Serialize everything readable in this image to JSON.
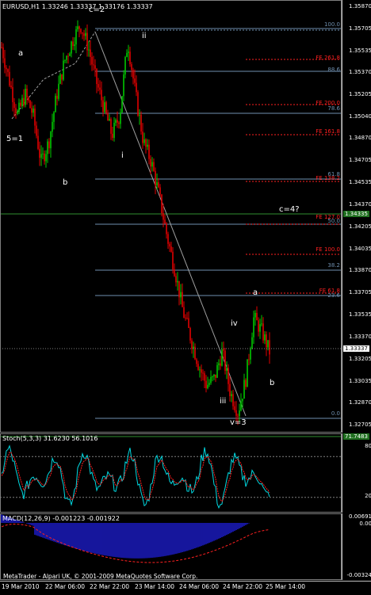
{
  "chart_header": "EURUSD,H1  1.33246 1.33337 1.33176 1.33337",
  "stoch_header": "Stoch(5,3,3) 31.6230 56.1016",
  "macd_header": "MACD(12,26,9) -0.001223 -0.001922",
  "copyright": "MetaTrader - Alpari UK, © 2001-2009 MetaQuotes Software Corp.",
  "current_price": "1.33337",
  "green_price": "1.34335",
  "stoch_value": "71.7483",
  "price_axis": [
    "1.35870",
    "1.35705",
    "1.35535",
    "1.35370",
    "1.35205",
    "1.35040",
    "1.34870",
    "1.34705",
    "1.34535",
    "1.34370",
    "1.34205",
    "1.34035",
    "1.33870",
    "1.33705",
    "1.33535",
    "1.33370",
    "1.33205",
    "1.33035",
    "1.32870",
    "1.32705"
  ],
  "stoch_axis": [
    "80",
    "20"
  ],
  "macd_axis": [
    "0.00691",
    "0.00",
    "-0.00324"
  ],
  "time_axis": [
    "19 Mar 2010",
    "22 Mar 06:00",
    "22 Mar 22:00",
    "23 Mar 14:00",
    "24 Mar 06:00",
    "24 Mar 22:00",
    "25 Mar 14:00"
  ],
  "wave_labels": {
    "c2": "c=2",
    "a_top": "a",
    "five1": "5=1",
    "b_left": "b",
    "ii": "ii",
    "i": "i",
    "c4": "c=4?",
    "a_right": "a",
    "iv": "iv",
    "b_right": "b",
    "iii": "iii",
    "v3": "v=3"
  },
  "fib_levels": {
    "f100": "100.0",
    "fe2618": "FE 261.8",
    "f886": "88.6",
    "fe2000": "FE 200.0",
    "f786": "78.6",
    "fe1618": "FE 161.8",
    "f618": "61.8",
    "fe1382": "FE 138.2",
    "fe1270": "FE 127.0",
    "f500": "50.0",
    "fe1000": "FE 100.0",
    "f382": "38.2",
    "fe0618": "FE 61.8",
    "f236": "23.6",
    "f00": "0.0"
  },
  "colors": {
    "bull": "#00c800",
    "bear": "#e00000",
    "stoch_main": "#00d8e0",
    "stoch_signal": "#ff2020",
    "macd_hist": "#2020e0",
    "macd_signal": "#ff2020",
    "fibo": "#6f8faf",
    "fe": "#ff2020"
  },
  "chart_data": {
    "type": "candlestick",
    "symbol": "EURUSD",
    "timeframe": "H1",
    "ohlc": {
      "open": 1.33246,
      "high": 1.33337,
      "low": 1.33176,
      "close": 1.33337
    },
    "ylim": [
      1.327,
      1.359
    ],
    "x_labels": [
      "19 Mar 2010",
      "22 Mar 06:00",
      "22 Mar 22:00",
      "23 Mar 14:00",
      "24 Mar 06:00",
      "24 Mar 22:00",
      "25 Mar 14:00"
    ],
    "close_path": [
      1.3555,
      1.353,
      1.3505,
      1.352,
      1.3505,
      1.347,
      1.3485,
      1.352,
      1.3545,
      1.356,
      1.3572,
      1.3555,
      1.353,
      1.351,
      1.349,
      1.3505,
      1.356,
      1.352,
      1.3485,
      1.347,
      1.3445,
      1.3415,
      1.339,
      1.336,
      1.334,
      1.332,
      1.3305,
      1.331,
      1.333,
      1.33,
      1.3285,
      1.331,
      1.3355,
      1.3345,
      1.333
    ],
    "stochastic": {
      "k": 31.623,
      "d": 56.1016,
      "levels": [
        80,
        20
      ]
    },
    "macd": {
      "main": -0.001223,
      "signal": -0.001922,
      "ylim": [
        -0.00324,
        0.00691
      ]
    }
  }
}
